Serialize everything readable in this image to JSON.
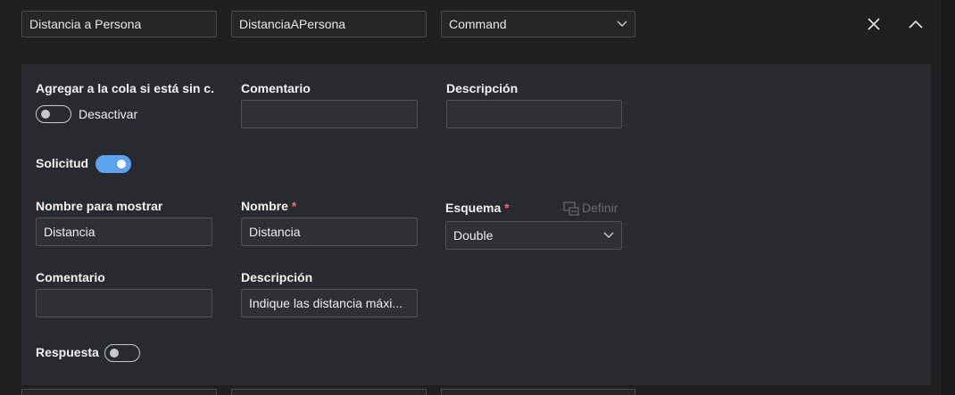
{
  "header": {
    "display_name_value": "Distancia a Persona",
    "name_value": "DistanciaAPersona",
    "type_value": "Command"
  },
  "panel": {
    "enqueue_label": "Agregar a la cola si está sin c...",
    "enqueue_toggle_text": "Desactivar",
    "comment_label": "Comentario",
    "comment_value": "",
    "description_label": "Descripción",
    "description_value": "",
    "request": {
      "label": "Solicitud",
      "enabled": true,
      "display_name_label": "Nombre para mostrar",
      "display_name_value": "Distancia",
      "name_label": "Nombre",
      "name_value": "Distancia",
      "schema_label": "Esquema",
      "schema_value": "Double",
      "define_label": "Definir",
      "comment_label": "Comentario",
      "comment_value": "",
      "description_label": "Descripción",
      "description_value": "Indique las distancia máxi..."
    },
    "response": {
      "label": "Respuesta",
      "enabled": false
    }
  },
  "required_marker": "*",
  "colors": {
    "accent": "#5aa3f0",
    "required": "#f16d6d",
    "panel_bg": "#272a2e"
  }
}
